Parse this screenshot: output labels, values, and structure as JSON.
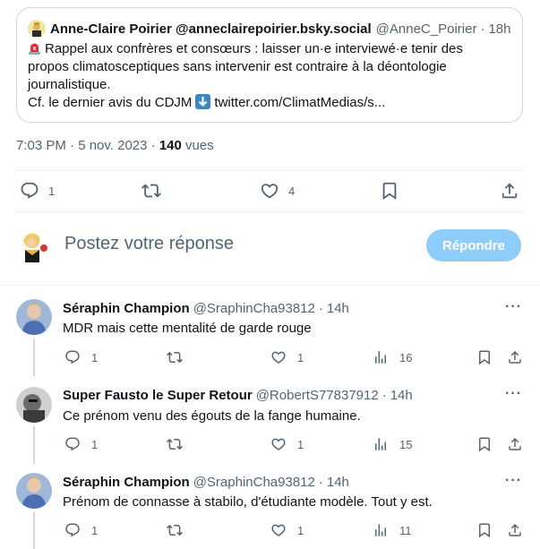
{
  "quote": {
    "author_name": "Anne-Claire Poirier @anneclairepoirier.bsky.social",
    "author_handle": "@AnneC_Poirier",
    "time": "18h",
    "line1": "Rappel aux confrères et consœurs : laisser un·e interviewé·e tenir des",
    "line2": "propos climatosceptiques sans intervenir est contraire à la déontologie",
    "line3": "journalistique.",
    "line4_a": "Cf. le dernier avis du CDJM",
    "line4_b": "twitter.com/ClimatMedias/s..."
  },
  "meta": {
    "datetime": "7:03 PM · 5 nov. 2023",
    "views_count": "140",
    "views_label": "vues"
  },
  "actions": {
    "reply_count": "1",
    "retweet_count": "",
    "like_count": "4"
  },
  "composer": {
    "placeholder": "Postez votre réponse",
    "reply_button": "Répondre"
  },
  "replies": [
    {
      "name": "Séraphin Champion",
      "handle": "@SraphinCha93812",
      "time": "14h",
      "text": "MDR mais cette mentalité de garde rouge",
      "replies": "1",
      "likes": "1",
      "views": "16"
    },
    {
      "name": "Super Fausto le Super Retour",
      "handle": "@RobertS77837912",
      "time": "14h",
      "text": "Ce prénom venu des égouts de la fange humaine.",
      "replies": "1",
      "likes": "1",
      "views": "15"
    },
    {
      "name": "Séraphin Champion",
      "handle": "@SraphinCha93812",
      "time": "14h",
      "text": "Prénom de connasse à stabilo, d'étudiante modèle. Tout y est.",
      "replies": "1",
      "likes": "1",
      "views": "11"
    }
  ],
  "colors": {
    "accent": "#1d9bf0",
    "reply_button_disabled": "#8ecdf8",
    "secondary_text": "#536471",
    "border": "#cfd9de"
  },
  "icons": [
    "reply-icon",
    "retweet-icon",
    "like-icon",
    "bookmark-icon",
    "share-icon",
    "views-icon",
    "more-icon",
    "siren-emoji",
    "down-arrow-emoji"
  ]
}
